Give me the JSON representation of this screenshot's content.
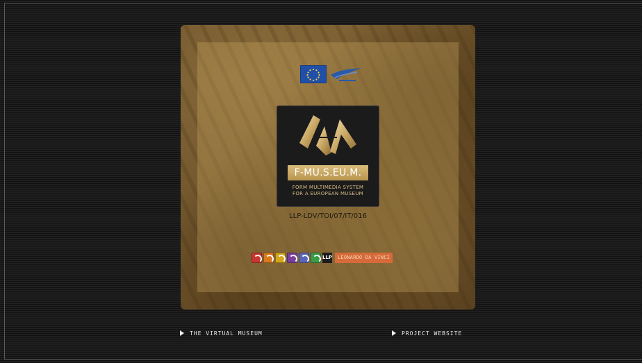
{
  "logo": {
    "title": "F-MU.S.EU.M.",
    "subtitle_line1": "FORM MULTIMEDIA SYSTEM",
    "subtitle_line2": "FOR A EUROPEAN MUSEUM"
  },
  "project_code": "LLP-LDV/TOI/07/IT/016",
  "programme": {
    "llp_tag": "LLP",
    "label": "LEONARDO DA VINCI",
    "icon_colors": [
      "#c8362f",
      "#d9781f",
      "#d4a51c",
      "#7a3f9b",
      "#5a67b8",
      "#3a9b48"
    ]
  },
  "nav": {
    "virtual_museum": "THE VIRTUAL MUSEUM",
    "project_website": "PROJECT WEBSITE"
  }
}
